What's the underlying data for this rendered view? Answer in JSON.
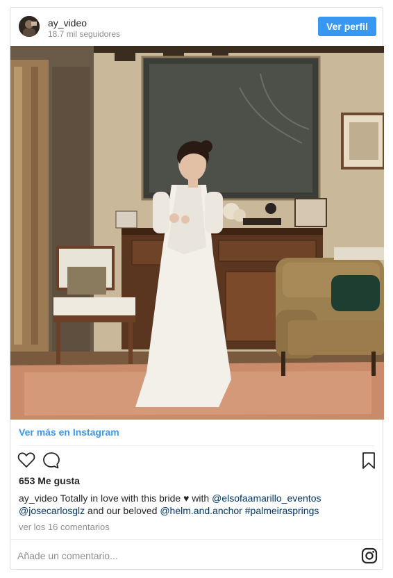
{
  "header": {
    "username": "ay_video",
    "followers": "18.7 mil seguidores",
    "follow_button": "Ver perfil"
  },
  "post": {
    "view_more_link": "Ver más en Instagram",
    "likes": "653 Me gusta",
    "caption": {
      "author": "ay_video",
      "text_1": " Totally in love with this bride ♥ with ",
      "mention_1": "@elsofaamarillo_eventos",
      "mention_2": "@josecarlosglz",
      "text_2": " and our beloved ",
      "mention_3": "@helm.and.anchor",
      "hashtag": "#palmeirasprings"
    },
    "comments_link": "ver los 16 comentarios",
    "comment_placeholder": "Añade un comentario..."
  },
  "icons": {
    "like": "heart-outline-icon",
    "comment": "speech-bubble-icon",
    "save": "bookmark-icon",
    "brand": "instagram-logo-icon"
  },
  "colors": {
    "accent": "#3897f0",
    "mention": "#003569",
    "muted": "#8e8e8e",
    "border": "#dbdbdb"
  }
}
